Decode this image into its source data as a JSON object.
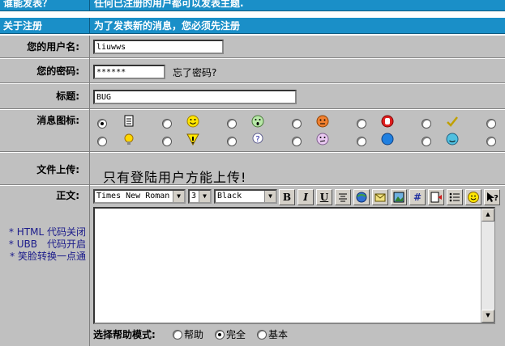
{
  "header_rows": [
    {
      "label": "谁能发表？",
      "text": "任何已注册的用户都可以发表主题."
    },
    {
      "label": "关于注册",
      "text": "为了发表新的消息，您必须先注册"
    }
  ],
  "form": {
    "username_label": "您的用户名:",
    "username_value": "liuwws",
    "password_label": "您的密码:",
    "password_value": "******",
    "forgot_link": "忘了密码?",
    "title_label": "标题:",
    "title_value": "BUG",
    "icon_label": "消息图标:",
    "upload_label": "文件上传:",
    "upload_notice": "只有登陆用户方能上传!",
    "body_label": "正文:",
    "notes": [
      "* HTML 代码关闭",
      "* UBB　代码开启",
      "* 笑脸转换一点通"
    ]
  },
  "editor": {
    "font": "Times New Roman",
    "size": "3",
    "color": "Black",
    "buttons": [
      "B",
      "I",
      "U"
    ],
    "help_mode_label": "选择帮助模式:",
    "help_modes": [
      "帮助",
      "完全",
      "基本"
    ],
    "help_mode_selected": "完全"
  },
  "colors": {
    "header": "#1a8fc8",
    "panel": "#c0c0c0"
  }
}
